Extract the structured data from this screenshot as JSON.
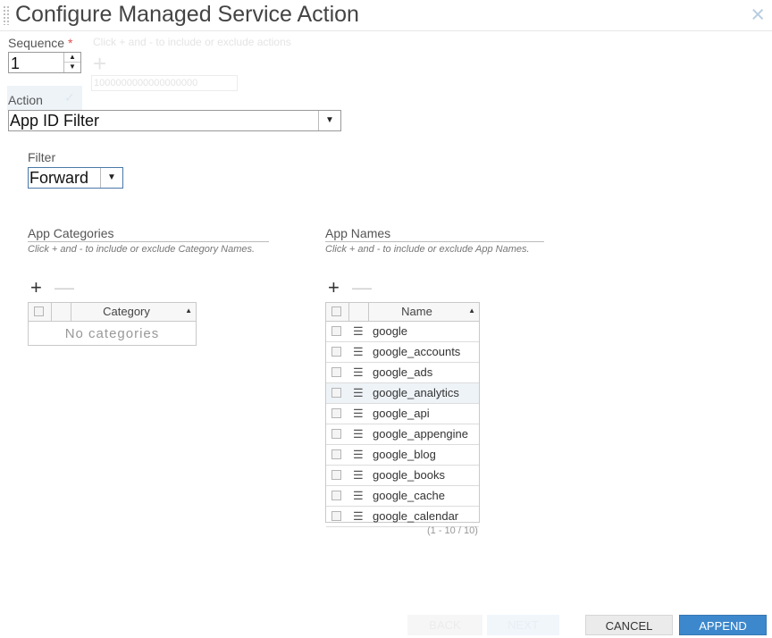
{
  "dialog": {
    "title": "Configure Managed Service Action",
    "close_icon": "×"
  },
  "background_ghost": {
    "hint": "Click + and - to include or exclude actions",
    "field": "1000000000000000000",
    "ok_glyph": "✓"
  },
  "sequence": {
    "label": "Sequence",
    "required_mark": "*",
    "value": "1",
    "up_glyph": "▲",
    "down_glyph": "▼"
  },
  "action": {
    "label": "Action",
    "value": "App ID Filter",
    "arrow": "▼"
  },
  "filter": {
    "label": "Filter",
    "value": "Forward",
    "arrow": "▼"
  },
  "categories": {
    "title": "App Categories",
    "hint": "Click + and - to include or exclude Category Names.",
    "add_glyph": "+",
    "remove_glyph": "—",
    "column": "Category",
    "sort_glyph": "▲",
    "empty_text": "No categories"
  },
  "names": {
    "title": "App Names",
    "hint": "Click + and - to include or exclude App Names.",
    "add_glyph": "+",
    "remove_glyph": "—",
    "column": "Name",
    "sort_glyph": "▲",
    "menu_glyph": "☰",
    "rows": [
      "google",
      "google_accounts",
      "google_ads",
      "google_analytics",
      "google_api",
      "google_appengine",
      "google_blog",
      "google_books",
      "google_cache",
      "google_calendar"
    ],
    "highlighted_row": "google_analytics",
    "pager": "(1 - 10 / 10)"
  },
  "footer": {
    "back": "BACK",
    "next": "NEXT",
    "cancel": "CANCEL",
    "append": "APPEND"
  },
  "colors": {
    "accent": "#3d88cc",
    "required": "#e05050",
    "close": "#b8cde0"
  }
}
